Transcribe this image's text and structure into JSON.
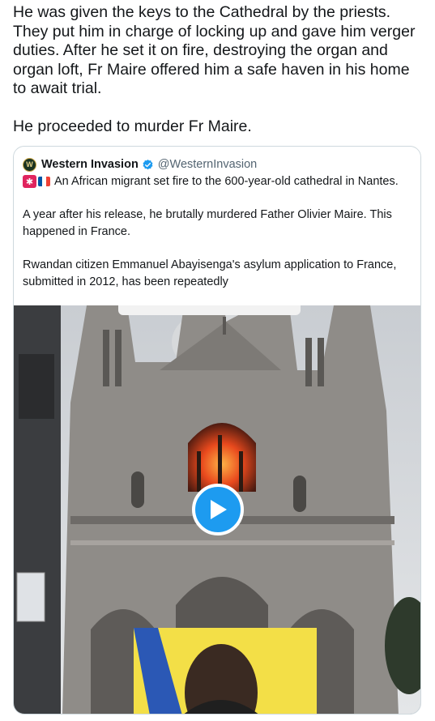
{
  "tweet": {
    "text": "He was given the keys to the Cathedral by the priests. They put him in charge of locking up and gave him verger duties. After he set it on fire, destroying the organ and organ loft, Fr Maire offered him a safe haven in his home to await trial.\n\nHe proceeded to murder Fr Maire."
  },
  "quote": {
    "display_name": "Western Invasion",
    "handle": "@WesternInvasion",
    "line1": "An African migrant set fire to the 600-year-old cathedral in Nantes.",
    "para1": "A year after his release, he brutally murdered Father Olivier Maire. This happened in France.",
    "para2": "Rwandan citizen Emmanuel Abayisenga's asylum application to France, submitted in 2012, has been repeatedly"
  },
  "icons": {
    "avatar": "western-invasion-logo",
    "verified": "verified-badge-icon",
    "siren": "police-light-emoji",
    "flag": "france-flag-emoji",
    "play": "play-icon"
  },
  "colors": {
    "accent": "#1d9bf0",
    "border": "#cfd9de",
    "muted": "#536471"
  }
}
